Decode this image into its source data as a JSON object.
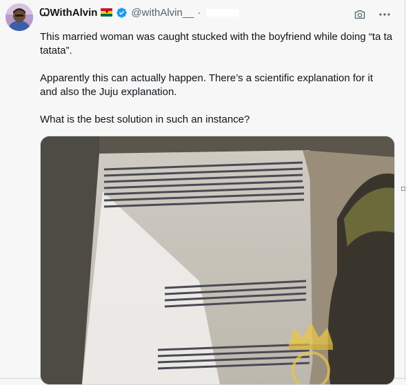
{
  "author": {
    "display_name": "ꞶWithAlvin",
    "handle": "@withAlvin__",
    "separator": "·",
    "verified": true,
    "flag": "ghana-flag-icon"
  },
  "actions": {
    "camera_icon": "camera-icon",
    "more_icon": "more-options-icon"
  },
  "tweet": {
    "paragraphs": [
      "This married woman was caught stucked with the boyfriend while doing “ta ta tatata”.",
      "Apparently this can actually happen. There’s a scientific explanation for it and also the Juju explanation.",
      "What is the best solution in such an instance?"
    ]
  },
  "media": {
    "type": "video-still",
    "watermark_icon": "crown-watermark-icon"
  },
  "colors": {
    "verified_blue": "#1d9bf0",
    "text": "#0f1419",
    "muted": "#536471",
    "background": "#f7f7f7"
  }
}
